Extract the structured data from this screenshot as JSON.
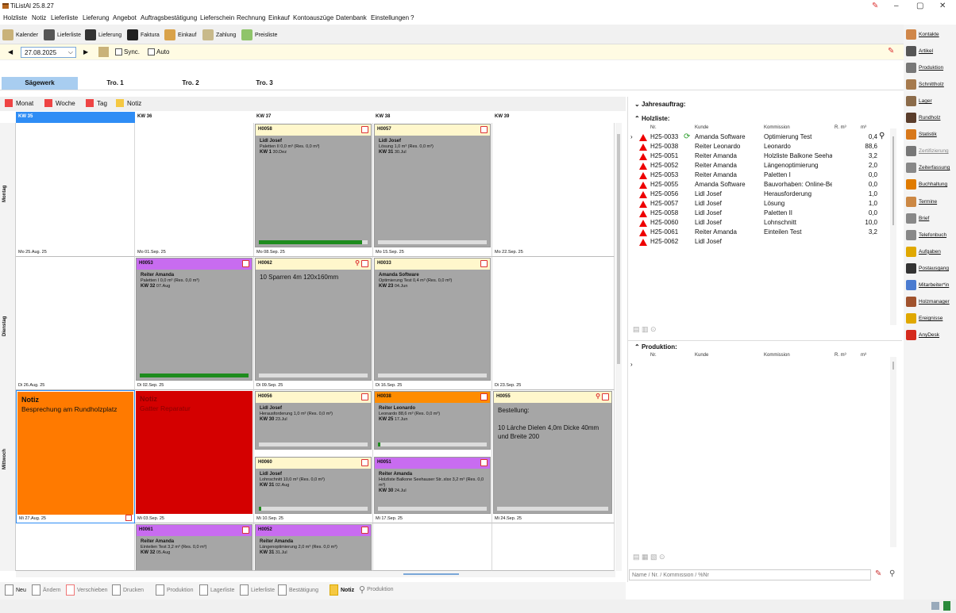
{
  "window": {
    "title": "TiListAl 25.8.27",
    "minimize": "–",
    "maximize": "▢",
    "close": "✕"
  },
  "menu": [
    "Holzliste",
    "Notiz",
    "Lieferliste",
    "Lieferung",
    "Angebot",
    "Auftragsbestätigung",
    "Lieferschein",
    "Rechnung",
    "Einkauf",
    "Kontoauszüge",
    "Datenbank",
    "Einstellungen",
    "?"
  ],
  "toolbar": [
    "Kalender",
    "Lieferliste",
    "Lieferung",
    "Faktura",
    "Einkauf",
    "Zahlung",
    "Preisliste"
  ],
  "datebar": {
    "date": "27.08.2025",
    "sync": "Sync.",
    "auto": "Auto"
  },
  "tabs": [
    "Sägewerk",
    "Tro. 1",
    "Tro. 2",
    "Tro. 3"
  ],
  "views": [
    "Monat",
    "Woche",
    "Tag",
    "Notiz"
  ],
  "weeks": [
    "KW 35",
    "KW 36",
    "KW 37",
    "KW 38",
    "KW 39"
  ],
  "days": [
    "Montag",
    "Dienstag",
    "Mittwoch"
  ],
  "dates": [
    [
      "Mo 25.Aug. 25",
      "Mo 01.Sep. 25",
      "Mo 08.Sep. 25",
      "Mo 15.Sep. 25",
      "Mo 22.Sep. 25"
    ],
    [
      "Di 26.Aug. 25",
      "Di 02.Sep. 25",
      "Di 09.Sep. 25",
      "Di 16.Sep. 25",
      "Di 23.Sep. 25"
    ],
    [
      "Mi 27.Aug. 25",
      "Mi 03.Sep. 25",
      "Mi 10.Sep. 25",
      "Mi 17.Sep. 25",
      "Mi 24.Sep. 25"
    ]
  ],
  "cards": {
    "h0058": {
      "id": "H0058",
      "name": "Lidl Josef",
      "desc": "Paletten II 0,0 m³ (Res. 0,0 m³)",
      "kw": "KW 1",
      "kwdate": "30.Dez",
      "progress": 0.95
    },
    "h0057": {
      "id": "H0057",
      "name": "Lidl Josef",
      "desc": "Lösung 1,0 m³ (Res. 0,0 m³)",
      "kw": "KW 31",
      "kwdate": "30.Jul",
      "progress": 0
    },
    "h0053": {
      "id": "H0053",
      "name": "Reiter Amanda",
      "desc": "Paletten I 0,0 m³ (Res. 0,0 m³)",
      "kw": "KW 32",
      "kwdate": "07.Aug",
      "progress": 1.0
    },
    "h0062": {
      "id": "H0062",
      "text": "10 Sparren 4m 120x160mm",
      "progress": 0
    },
    "h0033": {
      "id": "H0033",
      "name": "Amanda Software",
      "desc": "Optimierung Test 0,4 m³ (Res. 0,0 m³)",
      "kw": "KW 23",
      "kwdate": "04.Jun",
      "progress": 0
    },
    "h0056": {
      "id": "H0056",
      "name": "Lidl Josef",
      "desc": "Herausforderung 1,0 m³ (Res. 0,0 m³)",
      "kw": "KW 30",
      "kwdate": "23.Jul",
      "progress": 0
    },
    "h0038": {
      "id": "H0038",
      "name": "Reiter Leonardo",
      "desc": "Leonardo 88,6 m³ (Res. 0,0 m³)",
      "kw": "KW 25",
      "kwdate": "17.Jun",
      "progress": 0.02
    },
    "h0055": {
      "id": "H0055",
      "text": "Bestellung:\n\n10 Lärche Dielen 4,0m Dicke 40mm und Breite 200",
      "progress": 0
    },
    "h0060": {
      "id": "H0060",
      "name": "Lidl Josef",
      "desc": "Lohnschnitt 10,0 m³ (Res. 0,0 m³)",
      "kw": "KW 31",
      "kwdate": "02.Aug",
      "progress": 0.02
    },
    "h0051": {
      "id": "H0051",
      "name": "Reiter Amanda",
      "desc": "Holzliste Balkone Seehauser Str..xlsx 3,2 m³ (Res. 0,0 m³)",
      "kw": "KW 30",
      "kwdate": "24.Jul",
      "progress": 0
    },
    "h0061": {
      "id": "H0061",
      "name": "Reiter Amanda",
      "desc": "Einteilen Test 3,2 m³ (Res. 0,0 m³)",
      "kw": "KW 32",
      "kwdate": "05.Aug"
    },
    "h0052": {
      "id": "H0052",
      "name": "Reiter Amanda",
      "desc": "Längenoptimierung 2,0 m³ (Res. 0,0 m³)",
      "kw": "KW 31",
      "kwdate": "31.Jul"
    }
  },
  "notes": {
    "n1": {
      "title": "Notiz",
      "text": "Besprechung am Rundholzplatz"
    },
    "n2": {
      "title": "Notiz",
      "text": "Gatter Reparatur"
    }
  },
  "colors": {
    "orange": "#ff7a00",
    "red": "#d40000",
    "purple": "#c86cf0",
    "yellow": "#fff7cc",
    "blue": "#2f8df5",
    "header_orange": "#ff8c00"
  },
  "jahresauftrag": "Jahresauftrag:",
  "holzliste": {
    "title": "Holzliste:",
    "cols": [
      "Nr.",
      "Kunde",
      "Kommission",
      "R. m³",
      "m³"
    ],
    "rows": [
      [
        "H25-0033",
        "Amanda Software",
        "Optimierung Test",
        "0,4"
      ],
      [
        "H25-0038",
        "Reiter Leonardo",
        "Leonardo",
        "88,6"
      ],
      [
        "H25-0051",
        "Reiter Amanda",
        "Holzliste Balkone Seehau",
        "3,2"
      ],
      [
        "H25-0052",
        "Reiter Amanda",
        "Längenoptimierung",
        "2,0"
      ],
      [
        "H25-0053",
        "Reiter Amanda",
        "Paletten I",
        "0,0"
      ],
      [
        "H25-0055",
        "Amanda Software",
        "Bauvorhaben: Online-Be",
        "0,0"
      ],
      [
        "H25-0056",
        "Lidl Josef",
        "Herausforderung",
        "1,0"
      ],
      [
        "H25-0057",
        "Lidl Josef",
        "Lösung",
        "1,0"
      ],
      [
        "H25-0058",
        "Lidl Josef",
        "Paletten II",
        "0,0"
      ],
      [
        "H25-0060",
        "Lidl Josef",
        "Lohnschnitt",
        "10,0"
      ],
      [
        "H25-0061",
        "Reiter Amanda",
        "Einteilen Test",
        "3,2"
      ],
      [
        "H25-0062",
        "Lidl Josef",
        "",
        ""
      ]
    ]
  },
  "produktion": {
    "title": "Produktion:",
    "cols": [
      "Nr.",
      "Kunde",
      "Kommission",
      "R. m³",
      "m³"
    ]
  },
  "search": {
    "placeholder": "Name / Nr. / Kommission / %Nr"
  },
  "sidebar": [
    "Kontakte",
    "Artikel",
    "Produktion",
    "Schnittholz",
    "Lager",
    "Rundholz",
    "Statistik",
    "Zertifizierung",
    "Zeiterfassung",
    "Buchhaltung",
    "Termine",
    "Brief",
    "Telefonbuch",
    "Aufgaben",
    "Postausgang",
    "Mitarbeiter*in",
    "Holzmanager",
    "Ereignisse",
    "AnyDesk"
  ],
  "bottom": [
    "Neu",
    "Ändern",
    "Verschieben",
    "Drucken",
    "Produktion",
    "Lagerliste",
    "Lieferliste",
    "Bestätigung",
    "Notiz",
    "Produktion"
  ]
}
